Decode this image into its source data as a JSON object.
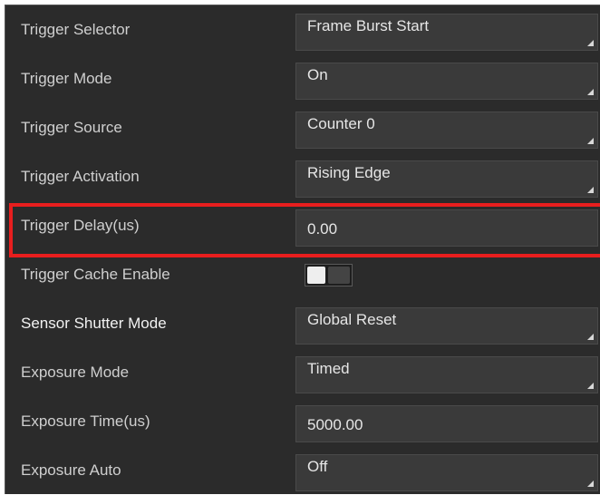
{
  "rows": [
    {
      "label": "Trigger Selector",
      "value": "Frame Burst Start",
      "kind": "dropdown"
    },
    {
      "label": "Trigger Mode",
      "value": "On",
      "kind": "dropdown"
    },
    {
      "label": "Trigger Source",
      "value": "Counter 0",
      "kind": "dropdown"
    },
    {
      "label": "Trigger Activation",
      "value": "Rising Edge",
      "kind": "dropdown"
    },
    {
      "label": "Trigger Delay(us)",
      "value": "0.00",
      "kind": "text"
    },
    {
      "label": "Trigger Cache Enable",
      "value": "off",
      "kind": "toggle"
    },
    {
      "label": "Sensor Shutter Mode",
      "value": "Global Reset",
      "kind": "dropdown"
    },
    {
      "label": "Exposure Mode",
      "value": "Timed",
      "kind": "dropdown"
    },
    {
      "label": "Exposure Time(us)",
      "value": "5000.00",
      "kind": "text"
    },
    {
      "label": "Exposure Auto",
      "value": "Off",
      "kind": "dropdown"
    }
  ],
  "highlight_color": "#e81e1e",
  "panel_bg": "#2b2b2b",
  "field_bg": "#3a3a3a"
}
